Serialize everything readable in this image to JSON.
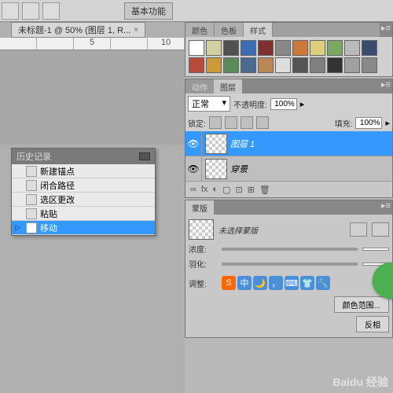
{
  "toolbar": {
    "essentials": "基本功能"
  },
  "document": {
    "tab_title": "未标题-1 @ 50% (图层 1, R..."
  },
  "ruler": {
    "ticks": [
      "",
      "",
      "5",
      "",
      "10"
    ]
  },
  "history": {
    "title": "历史记录",
    "items": [
      "新建锚点",
      "闭合路径",
      "选区更改",
      "粘贴",
      "移动"
    ],
    "selected": 4
  },
  "color_tabs": {
    "color": "颜色",
    "swatches": "色板",
    "styles": "样式"
  },
  "swatch_colors": [
    "#ffffff",
    "#d0d0a0",
    "#505050",
    "#3a6db5",
    "#803030",
    "#888888",
    "#cc7a3a",
    "#dcd07a",
    "#7aa860",
    "#bbbbbb",
    "#3a4a70",
    "#b84a3a",
    "#cc9a3a",
    "#5a8a5a",
    "#4a6a90",
    "#bb8855",
    "#dddddd",
    "#555555",
    "#808080",
    "#333333",
    "#a0a0a0",
    "#888888"
  ],
  "actions": {
    "tab1": "动作",
    "tab2": "图层"
  },
  "layers": {
    "blend": "正常",
    "opacity_label": "不透明度:",
    "opacity": "100%",
    "lock_label": "锁定:",
    "fill_label": "填充:",
    "fill": "100%",
    "items": [
      {
        "name": "图层 1",
        "visible": true
      },
      {
        "name": "穿景",
        "visible": true
      }
    ],
    "selected": 0,
    "footer_icons": [
      "∞",
      "fx",
      "◐",
      "▢",
      "⊡",
      "⊞",
      "🗑"
    ]
  },
  "mask": {
    "title": "蒙版",
    "none": "未选择蒙版",
    "density_label": "浓度:",
    "feather_label": "羽化:",
    "adjust_label": "调整:",
    "color_range": "颜色范围...",
    "invert": "反相"
  },
  "ime": {
    "items": [
      {
        "bg": "#ff6600",
        "txt": "S"
      },
      {
        "bg": "#4a90d9",
        "txt": "中"
      },
      {
        "bg": "#4a90d9",
        "txt": "🌙"
      },
      {
        "bg": "#4a90d9",
        "txt": "，"
      },
      {
        "bg": "#4a90d9",
        "txt": "⌨"
      },
      {
        "bg": "#4a90d9",
        "txt": "👕"
      },
      {
        "bg": "#4a90d9",
        "txt": "🔧"
      }
    ]
  },
  "watermark": "Baidu 经验"
}
